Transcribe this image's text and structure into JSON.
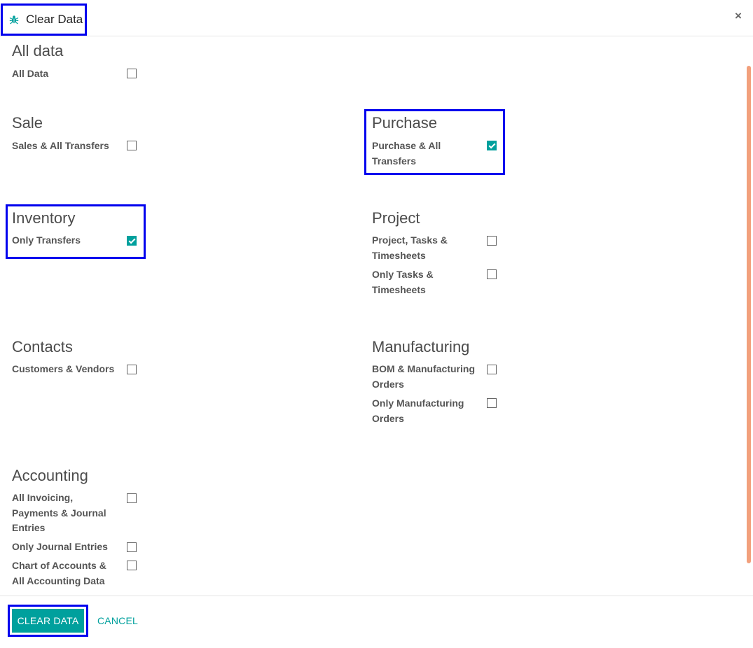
{
  "dialog": {
    "title": "Clear Data",
    "icon": "bug-icon",
    "close_label": "×"
  },
  "sections": {
    "all_data": {
      "title": "All data",
      "options": [
        {
          "label": "All Data",
          "checked": false
        }
      ]
    },
    "sale": {
      "title": "Sale",
      "options": [
        {
          "label": "Sales & All Transfers",
          "checked": false
        }
      ]
    },
    "purchase": {
      "title": "Purchase",
      "options": [
        {
          "label": "Purchase & All Transfers",
          "checked": true
        }
      ]
    },
    "inventory": {
      "title": "Inventory",
      "options": [
        {
          "label": "Only Transfers",
          "checked": true
        }
      ]
    },
    "project": {
      "title": "Project",
      "options": [
        {
          "label": "Project, Tasks & Timesheets",
          "checked": false
        },
        {
          "label": "Only Tasks & Timesheets",
          "checked": false
        }
      ]
    },
    "contacts": {
      "title": "Contacts",
      "options": [
        {
          "label": "Customers & Vendors",
          "checked": false
        }
      ]
    },
    "manufacturing": {
      "title": "Manufacturing",
      "options": [
        {
          "label": "BOM & Manufacturing Orders",
          "checked": false
        },
        {
          "label": "Only Manufacturing Orders",
          "checked": false
        }
      ]
    },
    "accounting": {
      "title": "Accounting",
      "options": [
        {
          "label": "All Invoicing, Payments & Journal Entries",
          "checked": false
        },
        {
          "label": "Only Journal Entries",
          "checked": false
        },
        {
          "label": "Chart of Accounts & All Accounting Data",
          "checked": false
        }
      ]
    }
  },
  "footer": {
    "primary_label": "CLEAR DATA",
    "cancel_label": "CANCEL"
  },
  "colors": {
    "accent": "#00a09d",
    "highlight": "#0000ee",
    "scrollbar": "#f2a07c"
  }
}
